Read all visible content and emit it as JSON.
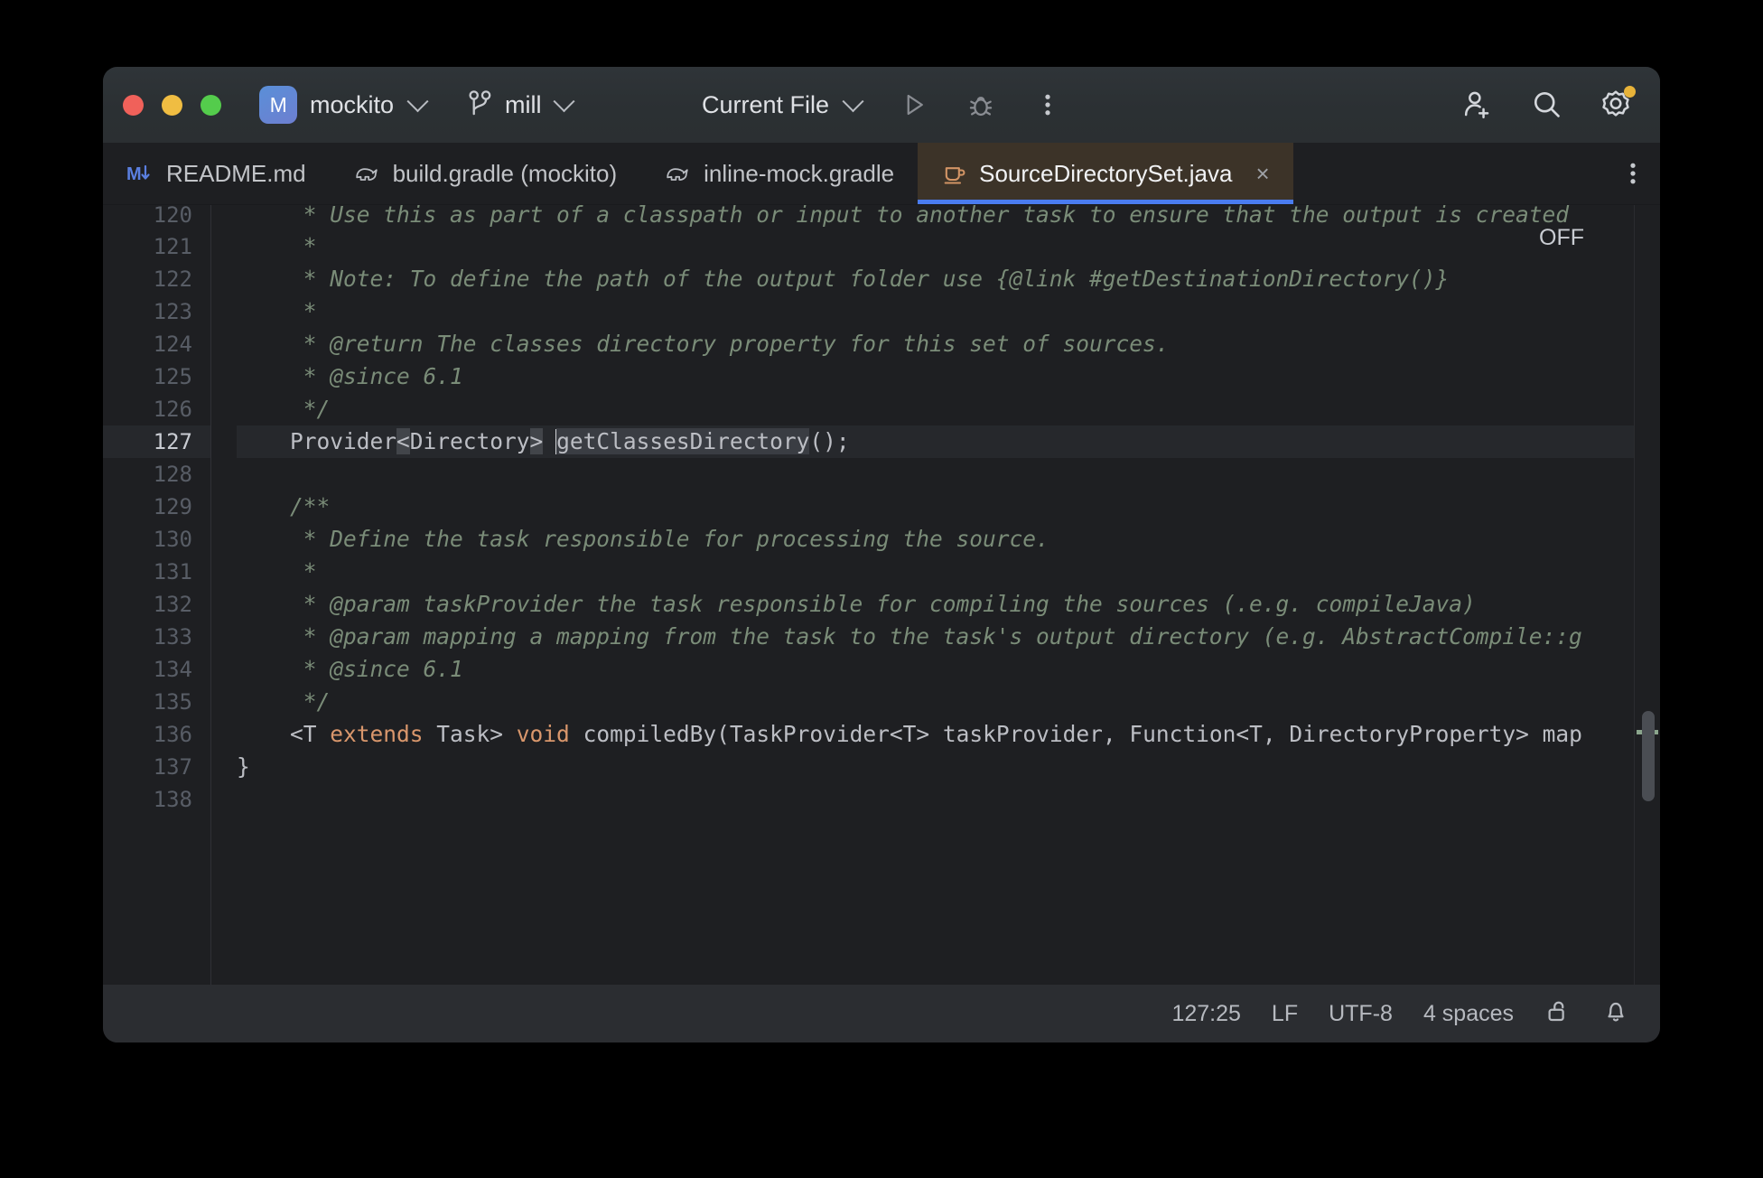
{
  "window": {
    "traffic_lights": [
      "close",
      "minimize",
      "zoom"
    ],
    "colors": {
      "close": "#f0615a",
      "minimize": "#f0bd42",
      "zoom": "#54cc4c",
      "tab_accent": "#4a7cf0",
      "active_tab_bg": "#3c3328",
      "gear_badge": "#e8b339",
      "editor_bg": "#1e1f22",
      "comment": "#7a8c78",
      "keyword": "#d9976c"
    }
  },
  "titlebar": {
    "project_badge": "M",
    "project_name": "mockito",
    "branch_icon": "branch-icon",
    "branch_name": "mill",
    "run_config": "Current File",
    "run_button": "run-icon",
    "debug_button": "debug-icon",
    "more_button": "more-options-icon",
    "add_user_button": "add-user-icon",
    "search_button": "search-icon",
    "settings_button": "gear-icon"
  },
  "tabs": [
    {
      "label": "README.md",
      "icon": "markdown-icon",
      "active": false,
      "closable": false
    },
    {
      "label": "build.gradle (mockito)",
      "icon": "gradle-icon",
      "active": false,
      "closable": false
    },
    {
      "label": "inline-mock.gradle",
      "icon": "gradle-icon",
      "active": false,
      "closable": false
    },
    {
      "label": "SourceDirectorySet.java",
      "icon": "java-icon",
      "active": true,
      "closable": true,
      "close_label": "×"
    }
  ],
  "tabbar_menu": "more-tabs-icon",
  "editor": {
    "inspections_widget": "OFF",
    "lines": [
      {
        "num": "120",
        "clipped": true,
        "current": false,
        "tokens": [
          {
            "t": "     * Use this as part of a classpath or input to another task to ensure that the output is created",
            "c": "cmt"
          }
        ]
      },
      {
        "num": "121",
        "clipped": false,
        "current": false,
        "tokens": [
          {
            "t": "     *",
            "c": "cmt"
          }
        ]
      },
      {
        "num": "122",
        "clipped": false,
        "current": false,
        "tokens": [
          {
            "t": "     * Note: To define the path of the output folder use {@link #getDestinationDirectory()}",
            "c": "cmt"
          }
        ]
      },
      {
        "num": "123",
        "clipped": false,
        "current": false,
        "tokens": [
          {
            "t": "     *",
            "c": "cmt"
          }
        ]
      },
      {
        "num": "124",
        "clipped": false,
        "current": false,
        "tokens": [
          {
            "t": "     * @return The classes directory property for this set of sources.",
            "c": "cmt"
          }
        ]
      },
      {
        "num": "125",
        "clipped": false,
        "current": false,
        "tokens": [
          {
            "t": "     * @since 6.1",
            "c": "cmt"
          }
        ]
      },
      {
        "num": "126",
        "clipped": false,
        "current": false,
        "tokens": [
          {
            "t": "     */",
            "c": "cmt"
          }
        ]
      },
      {
        "num": "127",
        "clipped": false,
        "current": true,
        "tokens": [
          {
            "t": "    Provider",
            "c": ""
          },
          {
            "t": "<",
            "c": "brk"
          },
          {
            "t": "Directory",
            "c": ""
          },
          {
            "t": ">",
            "c": "brk"
          },
          {
            "t": " ",
            "c": ""
          },
          {
            "t": "|CARET|",
            "c": "caret"
          },
          {
            "t": "getClassesDirectory",
            "c": "sel"
          },
          {
            "t": "();",
            "c": ""
          }
        ]
      },
      {
        "num": "128",
        "clipped": false,
        "current": false,
        "tokens": [
          {
            "t": "",
            "c": ""
          }
        ]
      },
      {
        "num": "129",
        "clipped": false,
        "current": false,
        "tokens": [
          {
            "t": "    /**",
            "c": "cmt"
          }
        ]
      },
      {
        "num": "130",
        "clipped": false,
        "current": false,
        "tokens": [
          {
            "t": "     * Define the task responsible for processing the source.",
            "c": "cmt"
          }
        ]
      },
      {
        "num": "131",
        "clipped": false,
        "current": false,
        "tokens": [
          {
            "t": "     *",
            "c": "cmt"
          }
        ]
      },
      {
        "num": "132",
        "clipped": false,
        "current": false,
        "tokens": [
          {
            "t": "     * @param taskProvider the task responsible for compiling the sources (.e.g. compileJava)",
            "c": "cmt"
          }
        ]
      },
      {
        "num": "133",
        "clipped": false,
        "current": false,
        "tokens": [
          {
            "t": "     * @param mapping a mapping from the task to the task's output directory (e.g. AbstractCompile::g",
            "c": "cmt"
          }
        ]
      },
      {
        "num": "134",
        "clipped": false,
        "current": false,
        "tokens": [
          {
            "t": "     * @since 6.1",
            "c": "cmt"
          }
        ]
      },
      {
        "num": "135",
        "clipped": false,
        "current": false,
        "tokens": [
          {
            "t": "     */",
            "c": "cmt"
          }
        ]
      },
      {
        "num": "136",
        "clipped": false,
        "current": false,
        "tokens": [
          {
            "t": "    <T ",
            "c": ""
          },
          {
            "t": "extends",
            "c": "kw"
          },
          {
            "t": " Task> ",
            "c": ""
          },
          {
            "t": "void",
            "c": "kw"
          },
          {
            "t": " compiledBy(TaskProvider<T> taskProvider, Function<T, DirectoryProperty> map",
            "c": ""
          }
        ]
      },
      {
        "num": "137",
        "clipped": false,
        "current": false,
        "tokens": [
          {
            "t": "}",
            "c": ""
          }
        ]
      },
      {
        "num": "138",
        "clipped": false,
        "current": false,
        "tokens": [
          {
            "t": "",
            "c": ""
          }
        ]
      }
    ]
  },
  "statusbar": {
    "caret_position": "127:25",
    "line_separator": "LF",
    "encoding": "UTF-8",
    "indent": "4 spaces",
    "lock_icon": "unlock-icon",
    "notifications_icon": "bell-icon"
  }
}
